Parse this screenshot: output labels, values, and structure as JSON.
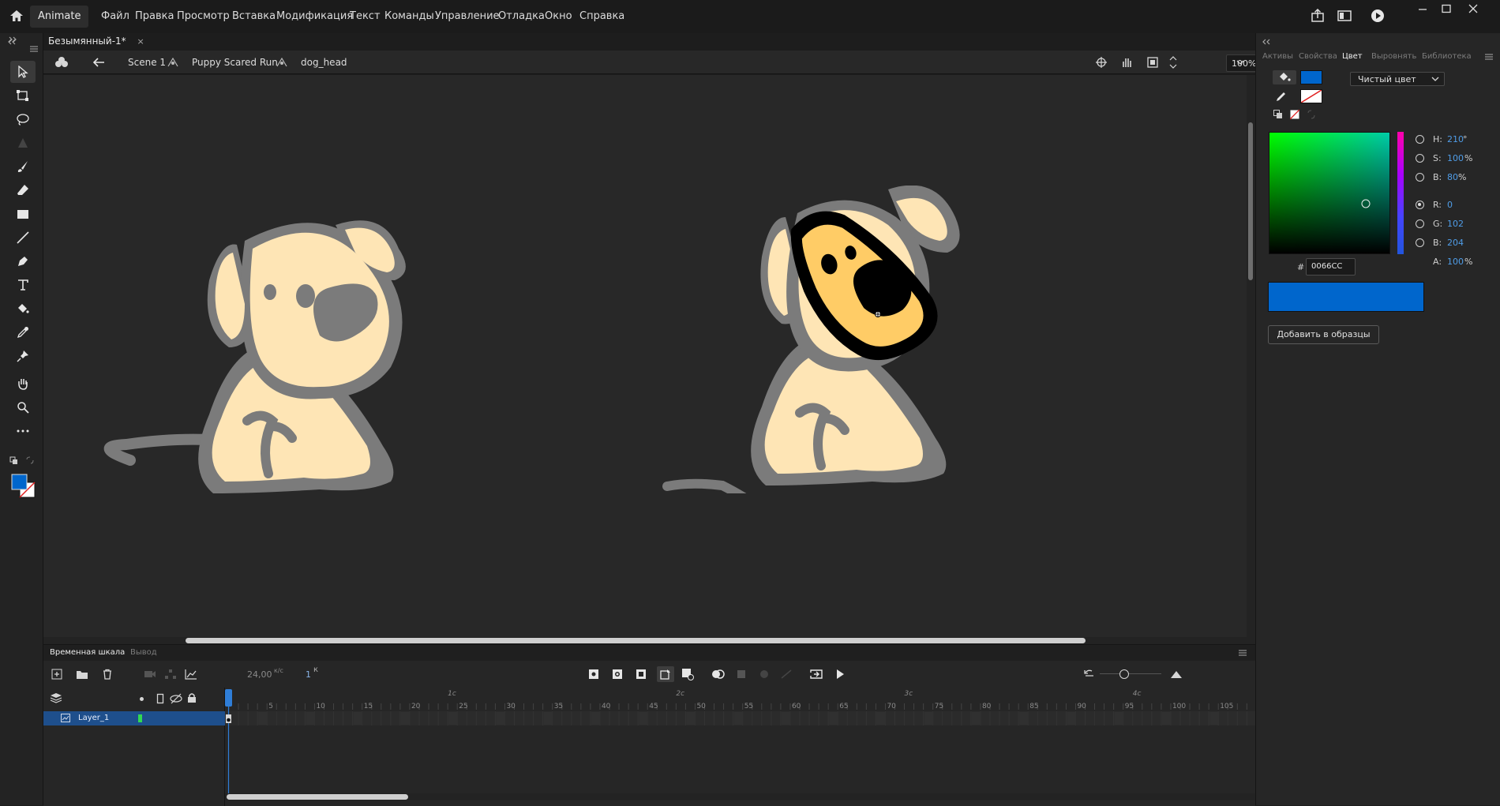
{
  "app": {
    "name": "Animate",
    "menu": [
      "Файл",
      "Правка",
      "Просмотр",
      "Вставка",
      "Модификация",
      "Текст",
      "Команды",
      "Управление",
      "Отладка",
      "Окно",
      "Справка"
    ]
  },
  "document": {
    "tab_title": "Безымянный-1*",
    "breadcrumb": {
      "scene": "Scene 1",
      "symbol1": "Puppy Scared Run",
      "symbol2": "dog_head"
    },
    "zoom": "100%"
  },
  "timeline": {
    "tabs": [
      "Временная шкала",
      "Вывод"
    ],
    "fps": "24,00",
    "fps_unit": "к/с",
    "current_frame": "1",
    "frame_unit": "к",
    "layer_name": "Layer_1",
    "seconds": [
      "1с",
      "2с",
      "3с",
      "4с"
    ],
    "frame_numbers": [
      "5",
      "10",
      "15",
      "20",
      "25",
      "30",
      "35",
      "40",
      "45",
      "50",
      "55",
      "60",
      "65",
      "70",
      "75",
      "80",
      "85",
      "90",
      "95",
      "100",
      "105"
    ]
  },
  "panels": {
    "tabs": [
      "Активы",
      "Свойства",
      "Цвет",
      "Выровнять",
      "Библиотека"
    ],
    "active_tab": "Цвет"
  },
  "color": {
    "fill_type": "Чистый цвет",
    "h_label": "H:",
    "h": "210",
    "h_unit": "°",
    "s_label": "S:",
    "s": "100",
    "s_unit": "%",
    "b_label": "B:",
    "b": "80",
    "b_unit": "%",
    "r_label": "R:",
    "r": "0",
    "g_label": "G:",
    "g": "102",
    "bl_label": "B:",
    "bl": "204",
    "a_label": "A:",
    "a": "100",
    "a_unit": "%",
    "hash": "#",
    "hex": "0066CC",
    "add_swatch_label": "Добавить в образцы",
    "fill_color": "#0066CC",
    "stroke_color": "none"
  }
}
